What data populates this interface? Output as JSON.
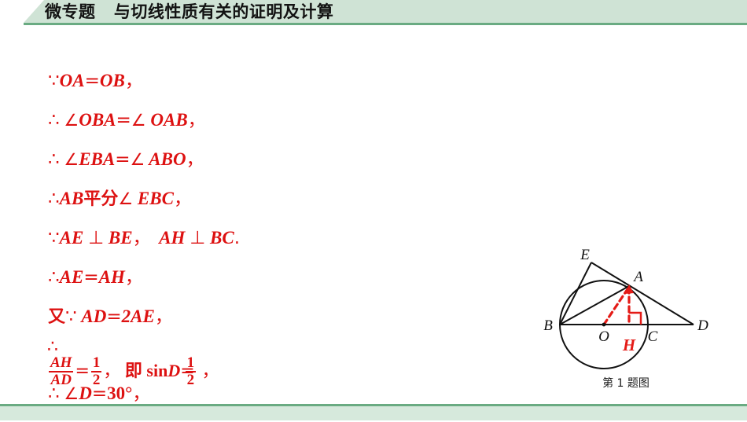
{
  "header": {
    "label": "微专题",
    "title": "与切线性质有关的证明及计算",
    "full_title": "微专题   与切线性质有关的证明及计算",
    "bg_color": "#cfe3d5",
    "accent_color": "#6aab82",
    "text_color": "#131313"
  },
  "solution": {
    "text_color": "#dd1111",
    "lines": [
      {
        "id": "l1",
        "text": "∵OA = OB ，"
      },
      {
        "id": "l2",
        "text": "∴ ∠OBA = ∠ OAB ，"
      },
      {
        "id": "l3",
        "text": "∴ ∠EBA = ∠ ABO ，"
      },
      {
        "id": "l4",
        "text": "∴AB 平分∠ EBC ，"
      },
      {
        "id": "l5",
        "text": "∵AE ⊥ BE ， AH ⊥ BC."
      },
      {
        "id": "l6",
        "text": "∴AE = AH ，"
      },
      {
        "id": "l7",
        "text": "又∵ AD = 2AE ，"
      },
      {
        "id": "l8",
        "text": "∴ AH/AD = 1/2， 即 sinD = 1/2 ，"
      },
      {
        "id": "l9",
        "text": "∴ ∠D = 30° ，"
      }
    ],
    "l1": {
      "because": "∵",
      "lhs": "OA",
      "eq": "=",
      "rhs": "OB",
      "comma": "，"
    },
    "l2": {
      "therefore": "∴",
      "angle1": "∠",
      "t1": "OBA",
      "eq": "=",
      "angle2": "∠",
      "t2": "OAB",
      "comma": "，"
    },
    "l3": {
      "therefore": "∴",
      "angle1": "∠",
      "t1": "EBA",
      "eq": "=",
      "angle2": "∠",
      "t2": "ABO",
      "comma": "，"
    },
    "l4": {
      "therefore": "∴",
      "t1": "AB",
      "cjk": "平分",
      "angle": "∠",
      "t2": "EBC",
      "comma": "，"
    },
    "l5": {
      "because": "∵",
      "t1": "AE",
      "perp1": "⊥",
      "t2": "BE",
      "comma": "，",
      "t3": "AH",
      "perp2": "⊥",
      "t4": "BC",
      "period": "."
    },
    "l6": {
      "therefore": "∴",
      "lhs": "AE",
      "eq": "=",
      "rhs": "AH",
      "comma": "，"
    },
    "l7": {
      "cjk": "又",
      "because": "∵",
      "lhs": "AD",
      "eq": "=",
      "rhs": "2AE",
      "comma": "，"
    },
    "l8": {
      "therefore": "∴",
      "f1_num": "AH",
      "f1_den": "AD",
      "eq1": "=",
      "f2_num": "1",
      "f2_den": "2",
      "comma1": "，",
      "cjk": "即",
      "sin": "sin",
      "var": "D",
      "eq2": "=",
      "f3_num": "1",
      "f3_den": "2",
      "comma2": "，"
    },
    "l9": {
      "therefore": "∴",
      "angle": "∠",
      "var": "D",
      "eq": "=",
      "value": "30°",
      "comma": "，"
    }
  },
  "figure": {
    "caption": "第 1 题图",
    "stroke_color": "#111111",
    "highlight_color": "#e41b17",
    "labels": {
      "E": "E",
      "A": "A",
      "B": "B",
      "O": "O",
      "C": "C",
      "D": "D",
      "H": "H"
    }
  },
  "footer": {
    "rule_color": "#6aab82",
    "band_color": "#d6e9dc"
  }
}
